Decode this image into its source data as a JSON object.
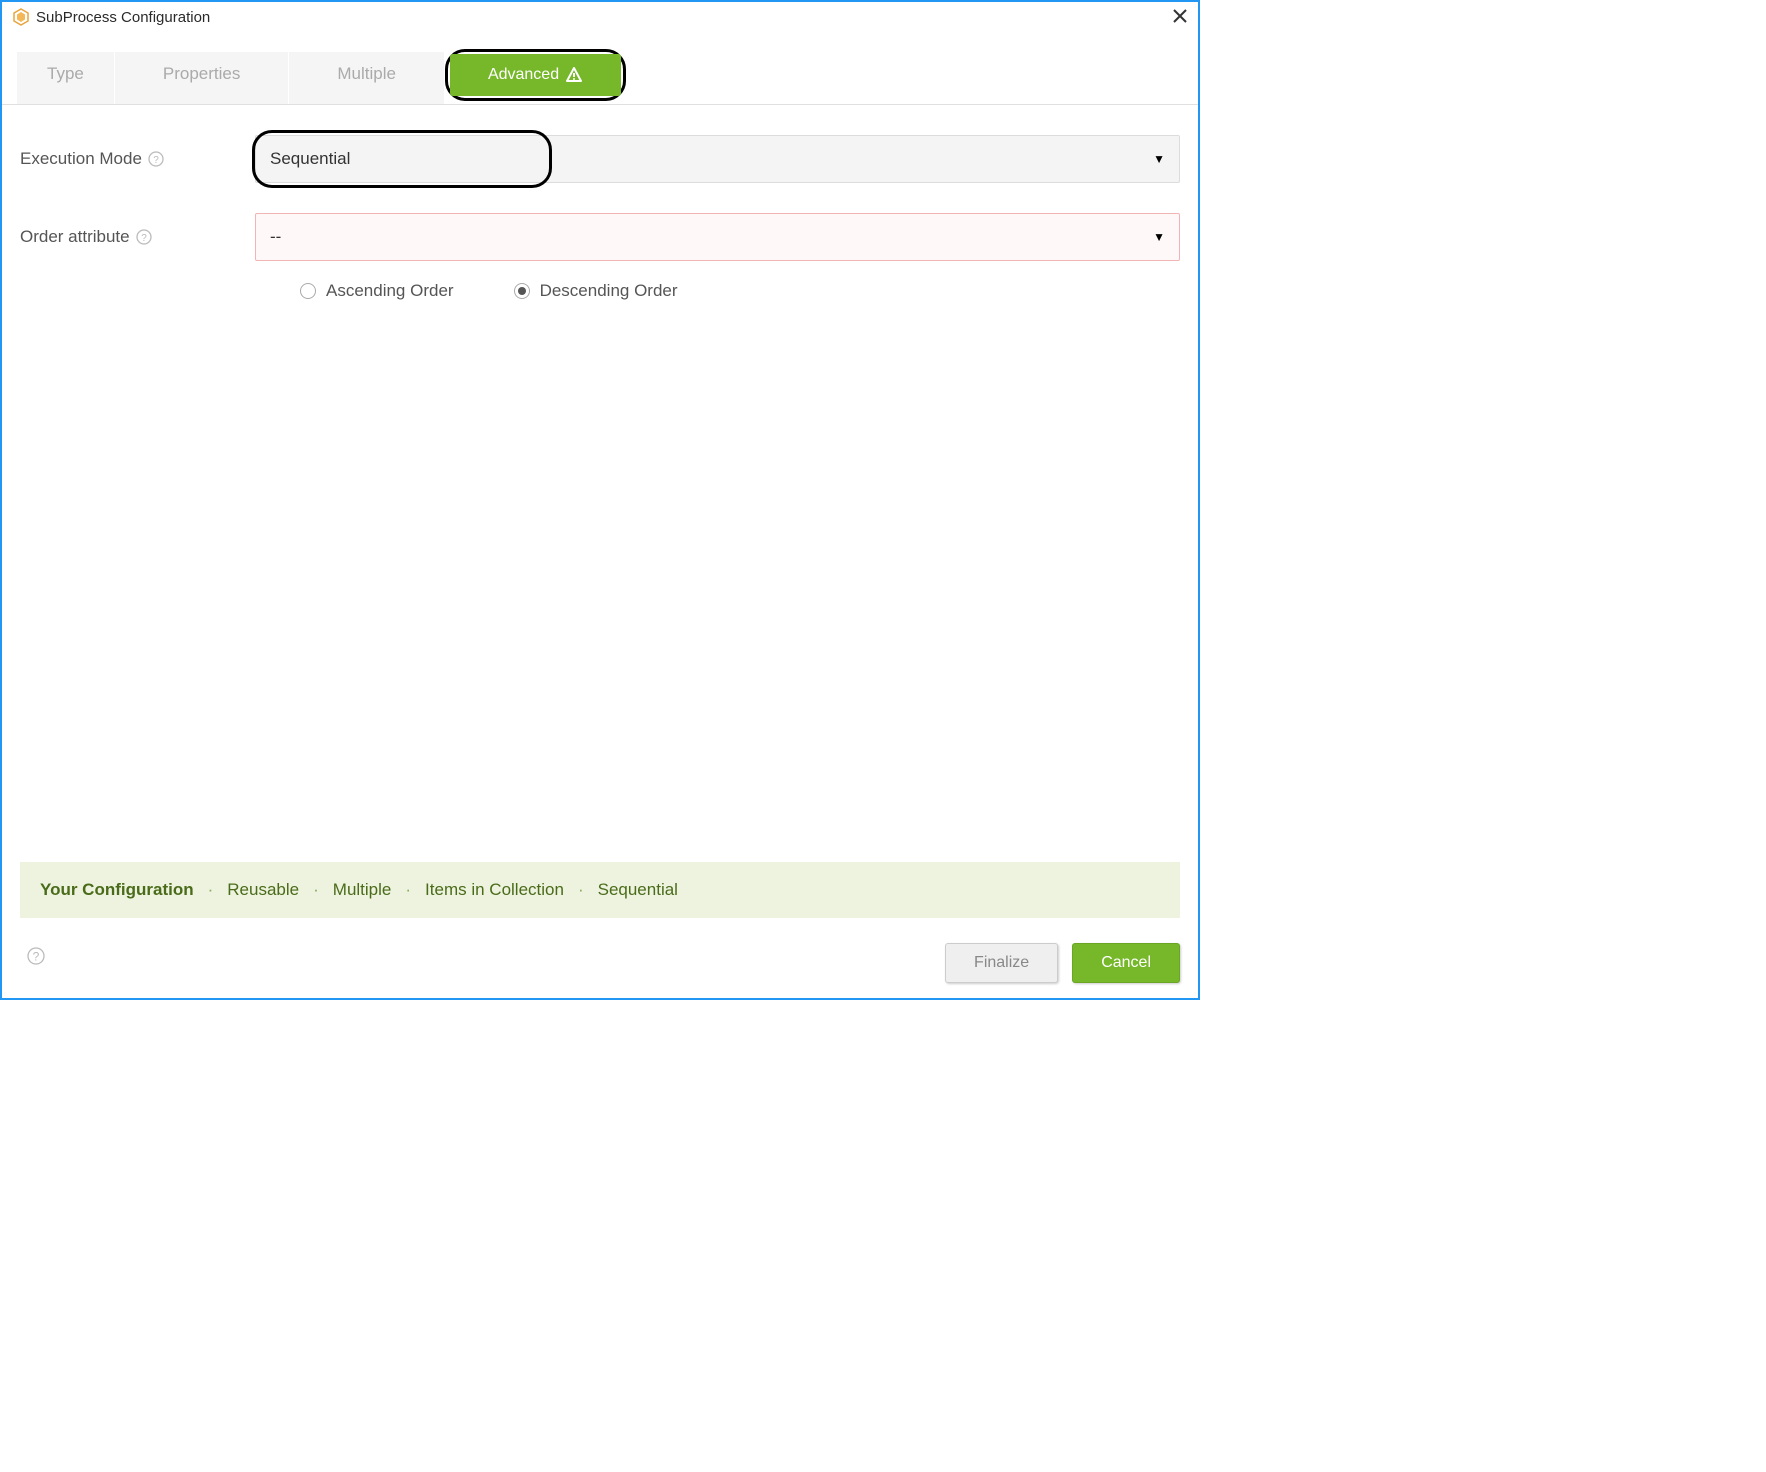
{
  "titlebar": {
    "title": "SubProcess Configuration"
  },
  "tabs": {
    "type": "Type",
    "properties": "Properties",
    "multiple": "Multiple",
    "advanced": "Advanced"
  },
  "form": {
    "execution_mode_label": "Execution Mode",
    "execution_mode_value": "Sequential",
    "order_attribute_label": "Order attribute",
    "order_attribute_value": "--",
    "ascending_label": "Ascending Order",
    "descending_label": "Descending Order"
  },
  "summary": {
    "label": "Your Configuration",
    "items": [
      "Reusable",
      "Multiple",
      "Items in Collection",
      "Sequential"
    ]
  },
  "footer": {
    "finalize": "Finalize",
    "cancel": "Cancel"
  }
}
